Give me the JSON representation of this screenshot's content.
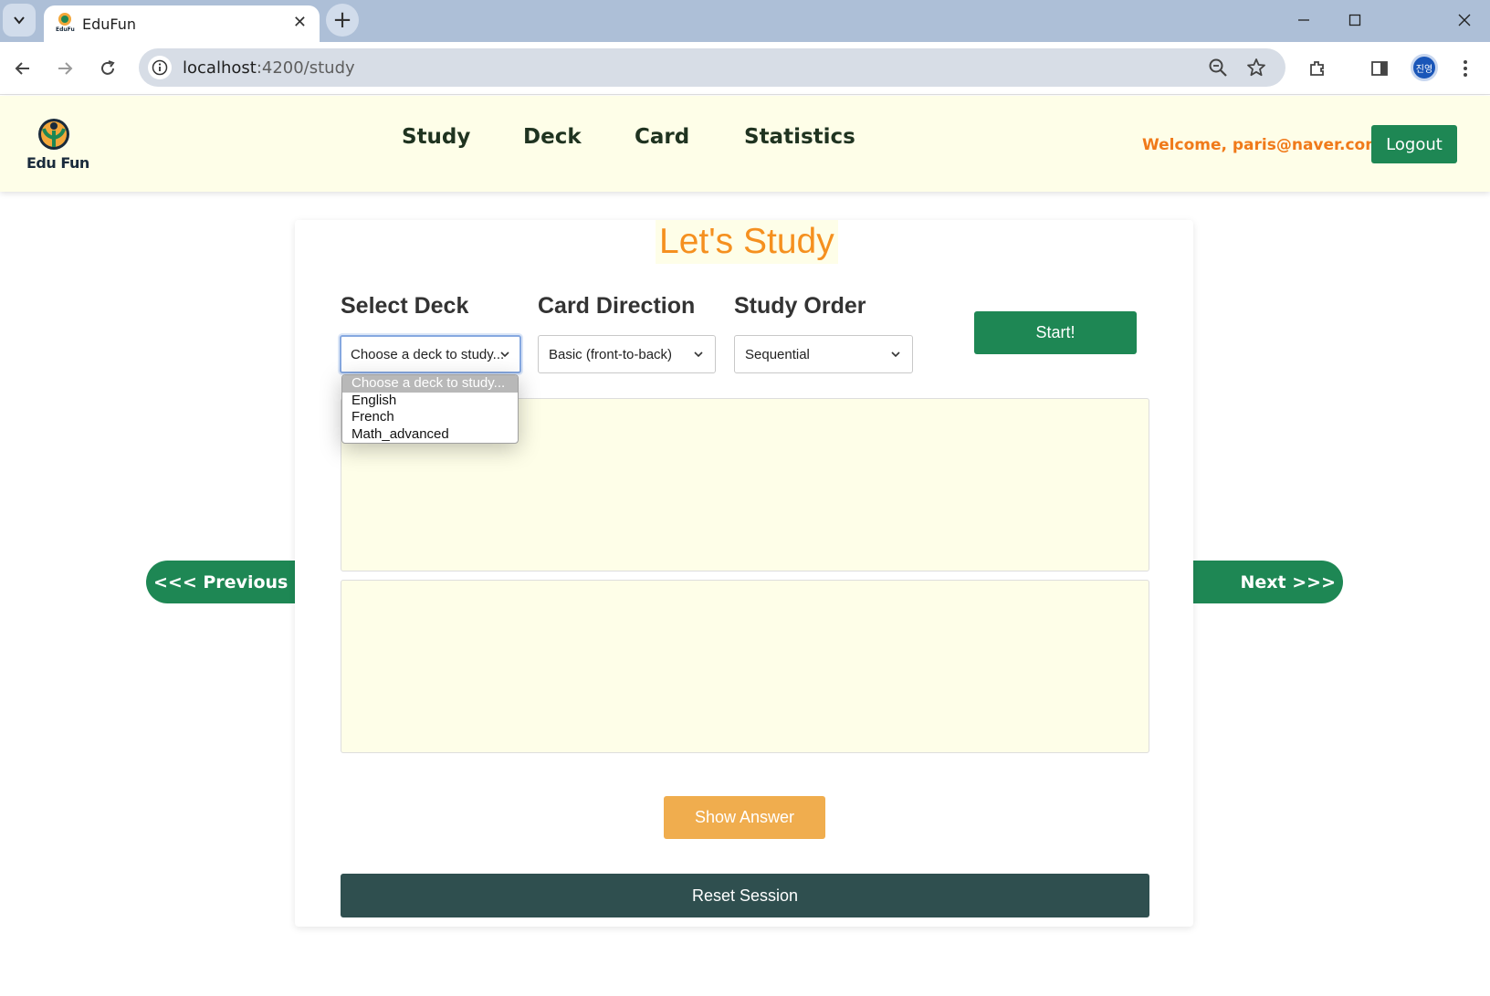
{
  "browser": {
    "tab_title": "EduFun",
    "url_host": "localhost",
    "url_path": ":4200/study",
    "profile_initials": "진영"
  },
  "header": {
    "logo_text": "Edu Fun",
    "nav": [
      "Study",
      "Deck",
      "Card",
      "Statistics"
    ],
    "welcome_prefix": "Welcome,",
    "user_email": "paris@naver.com!",
    "logout_label": "Logout"
  },
  "study": {
    "title": "Let's Study",
    "deck_label": "Select Deck",
    "deck_selected": "Choose a deck to study...",
    "deck_options": [
      "Choose a deck to study...",
      "English",
      "French",
      "Math_advanced"
    ],
    "direction_label": "Card Direction",
    "direction_selected": "Basic (front-to-back)",
    "order_label": "Study Order",
    "order_selected": "Sequential",
    "start_label": "Start!",
    "show_answer_label": "Show Answer",
    "reset_label": "Reset Session",
    "prev_label": "<<< Previous",
    "next_label": "Next >>>"
  },
  "colors": {
    "primary_green": "#1e8754",
    "accent_orange": "#f5901f",
    "show_answer": "#f0ad4e",
    "reset": "#2f4f4f",
    "card_bg": "#fefee8"
  }
}
